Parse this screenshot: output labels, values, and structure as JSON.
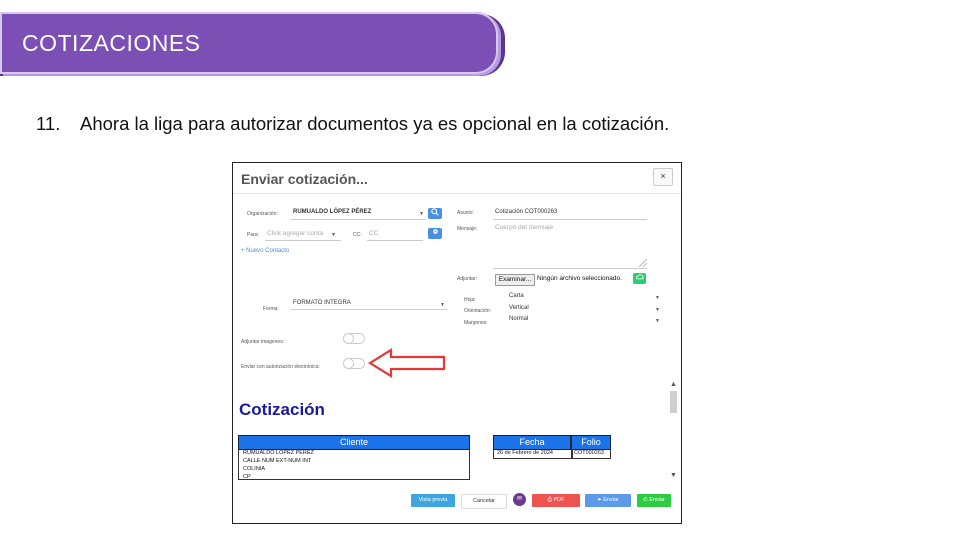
{
  "banner": {
    "title": "COTIZACIONES"
  },
  "step": {
    "number": "11.",
    "text": "Ahora la liga para autorizar documentos ya es opcional en la cotización."
  },
  "modal": {
    "title": "Enviar cotización...",
    "close_label": "×",
    "organizacion": {
      "label": "Organización:",
      "value": "RUMUALDO LÓPEZ PÉREZ"
    },
    "para": {
      "label": "Para:",
      "placeholder": "Click agregar conta"
    },
    "cc": {
      "label": "CC:",
      "placeholder": "CC"
    },
    "nuevo_contacto": "+ Nuevo Contacto",
    "asunto": {
      "label": "Asunto:",
      "value": "Cotización COT000263"
    },
    "mensaje": {
      "label": "Mensaje:",
      "placeholder": "Cuerpo del mensaje"
    },
    "adjuntar": {
      "label": "Adjuntar:",
      "button": "Examinar...",
      "status": "Ningún archivo seleccionado."
    },
    "formato": {
      "label": "Forma:",
      "value": "FORMATO INTEGRA"
    },
    "hoja": {
      "label": "Hoja:",
      "value": "Carta"
    },
    "orientacion": {
      "label": "Orientación:",
      "value": "Vertical"
    },
    "margenes": {
      "label": "Margenes:",
      "value": "Normal"
    },
    "adjuntar_imagenes": {
      "label": "Adjuntar imagenes:",
      "on": false
    },
    "autorizacion": {
      "label": "Enviar con autorización electrónica:",
      "on": false
    },
    "preview": {
      "title": "Cotización",
      "cliente_header": "Cliente",
      "cliente_lines": [
        "RUMUALDO LÓPEZ PÉREZ",
        "CALLE NUM EXT-NUM INT",
        "COLINIA",
        "CP"
      ],
      "fecha_header": "Fecha",
      "fecha_value": "26 de Febrero de 2024",
      "folio_header": "Folio",
      "folio_value": "COT000263"
    },
    "footer": {
      "vista_previa": "Vista previa",
      "cancelar": "Cancelar",
      "pdf": "PDF",
      "enviar": "Enviar",
      "whatsapp": "Enviar"
    }
  },
  "colors": {
    "banner": "#7b4fb3",
    "primary_blue": "#1a73e8",
    "pdf_red": "#ef5350",
    "send_blue": "#5b9bea",
    "whatsapp_green": "#2ecc40",
    "arrow_red": "#e53935"
  }
}
